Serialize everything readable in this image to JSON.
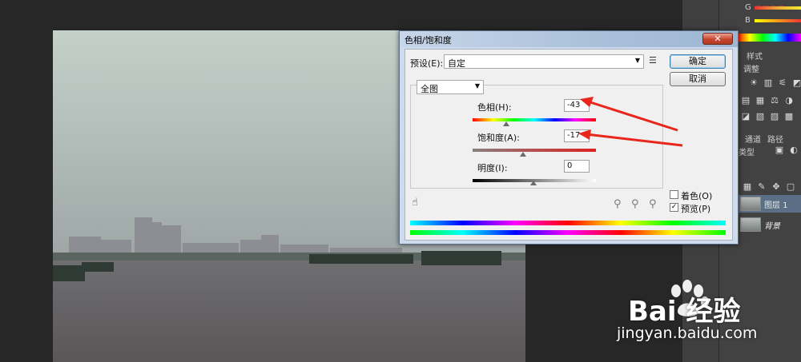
{
  "dialog": {
    "title": "色相/饱和度",
    "close_label": "✕",
    "preset_label": "预设(E):",
    "preset_value": "自定",
    "ok_label": "确定",
    "cancel_label": "取消",
    "channel_value": "全图",
    "hue_label": "色相(H):",
    "hue_value": "-43",
    "saturation_label": "饱和度(A):",
    "saturation_value": "-17",
    "lightness_label": "明度(I):",
    "lightness_value": "0",
    "colorize_label": "着色(O)",
    "preview_label": "预览(P)",
    "preview_check": "✓"
  },
  "panels": {
    "tab_styles": "样式",
    "tab_adjustments": "调整",
    "tab_channels": "通道",
    "tab_paths": "路径",
    "channel_g": "G",
    "channel_b": "B",
    "type_label": "类型",
    "layer1_name": "图层 1",
    "background_name": "背景"
  },
  "watermark": {
    "brand": "Bai 经验",
    "url": "jingyan.baidu.com"
  },
  "colors": {
    "arrow": "#e8261c",
    "dialog_frame": "#cfdbea"
  }
}
